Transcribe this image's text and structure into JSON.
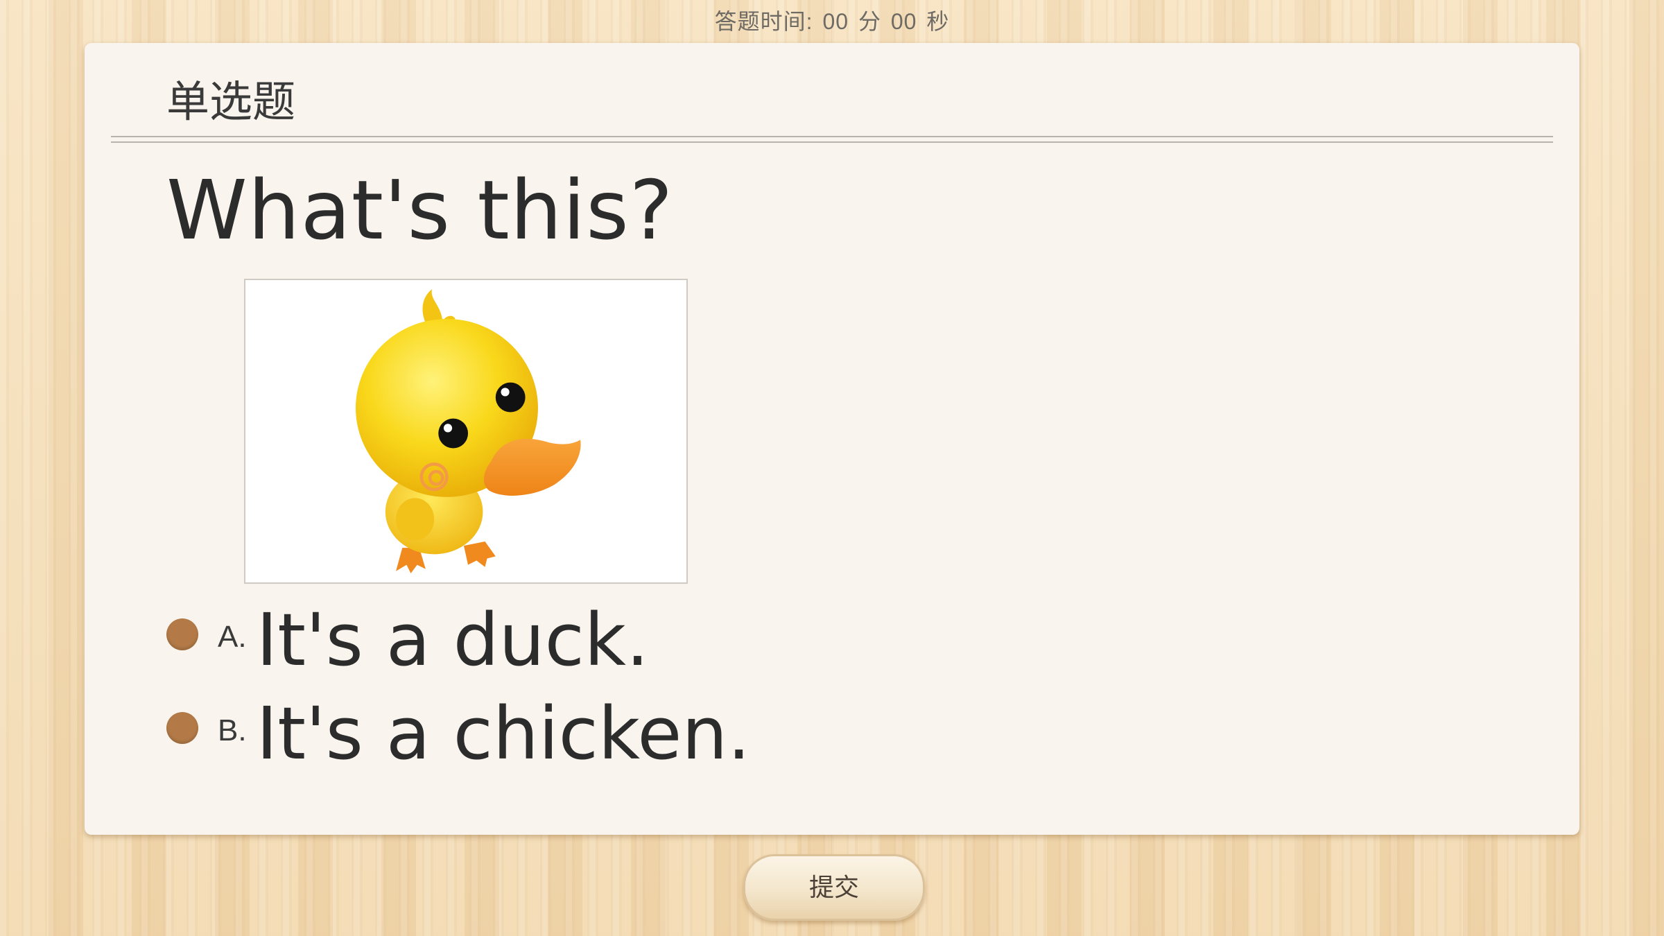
{
  "timer": {
    "label": "答题时间:",
    "minutes": "00",
    "minutes_unit": "分",
    "seconds": "00",
    "seconds_unit": "秒"
  },
  "question": {
    "type": "单选题",
    "prompt": "What's this?",
    "image_icon": "duck-illustration-icon"
  },
  "options": [
    {
      "letter": "A.",
      "text": "It's a duck."
    },
    {
      "letter": "B.",
      "text": "It's a chicken."
    }
  ],
  "submit": {
    "label": "提交"
  },
  "colors": {
    "radio": "#b37a47",
    "card": "#f9f5ee",
    "background": "#f3dcb6"
  }
}
